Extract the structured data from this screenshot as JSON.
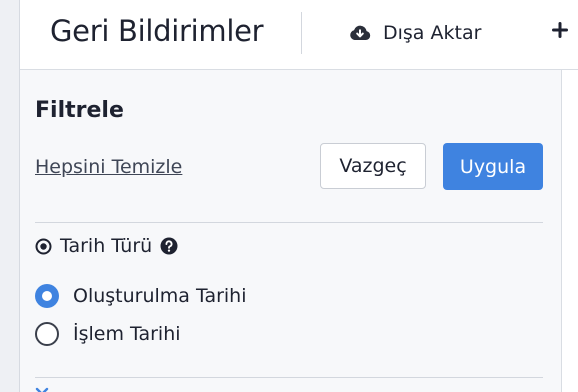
{
  "header": {
    "title": "Geri Bildirimler",
    "export_label": "Dışa Aktar",
    "export_icon": "cloud-download-icon",
    "add_icon": "plus-icon"
  },
  "filter_panel": {
    "title": "Filtrele",
    "clear_all_label": "Hepsini Temizle",
    "cancel_label": "Vazgeç",
    "apply_label": "Uygula",
    "date_type_section": {
      "label": "Tarih Türü",
      "section_icon": "radio-dot-icon",
      "help_icon": "question-circle-icon",
      "options": [
        {
          "label": "Oluşturulma Tarihi",
          "selected": true
        },
        {
          "label": "İşlem Tarihi",
          "selected": false
        }
      ]
    }
  },
  "colors": {
    "accent": "#3f83e0",
    "panel_background": "#f7f8fa",
    "text": "#1e2230"
  }
}
